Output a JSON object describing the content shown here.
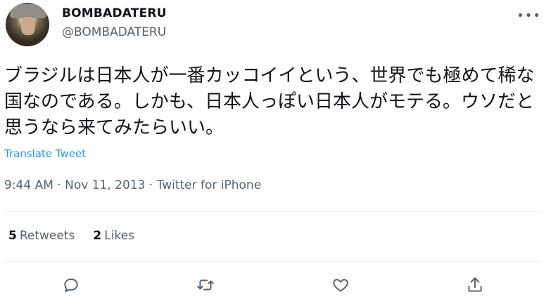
{
  "user": {
    "display_name": "BOMBADATERU",
    "handle": "@BOMBADATERU"
  },
  "tweet": {
    "text": "ブラジルは日本人が一番カッコイイという、世界でも極めて稀な国なのである。しかも、日本人っぽい日本人がモテる。ウソだと思うなら来てみたらいい。",
    "translate_label": "Translate Tweet",
    "time": "9:44 AM",
    "date": "Nov 11, 2013",
    "source": "Twitter for iPhone",
    "separator": "·"
  },
  "stats": {
    "retweets_count": "5",
    "retweets_label": "Retweets",
    "likes_count": "2",
    "likes_label": "Likes"
  },
  "icons": {
    "more": "more-horizontal-icon",
    "reply": "reply-icon",
    "retweet": "retweet-icon",
    "like": "heart-icon",
    "share": "share-icon"
  },
  "colors": {
    "link": "#1d9bf0",
    "secondary_text": "#536471",
    "primary_text": "#0f1419",
    "divider": "#eff3f4"
  }
}
